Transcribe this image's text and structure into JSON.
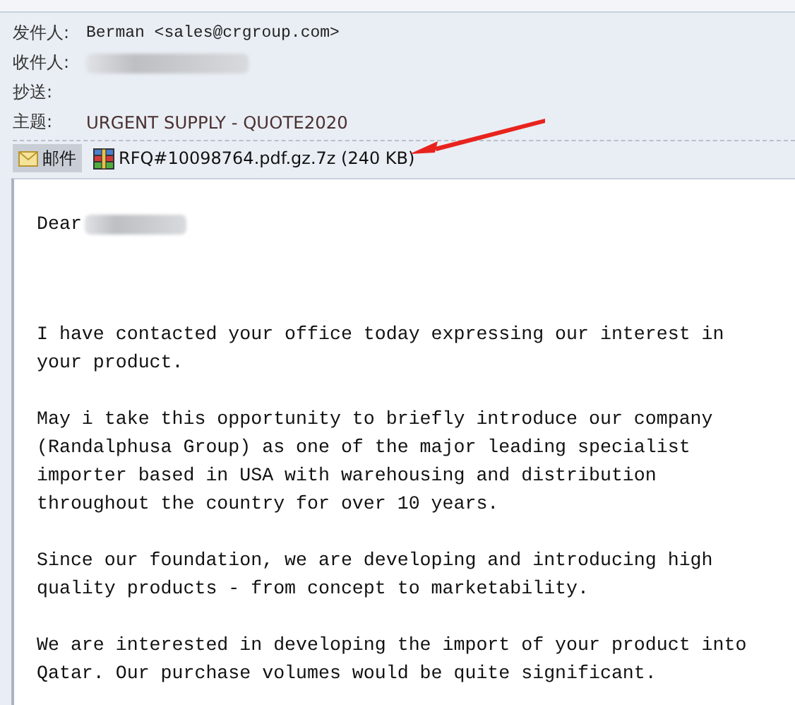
{
  "header": [
    {
      "label": "发件人:",
      "value": "Berman <sales@crgroup.com>"
    },
    {
      "label": "收件人:",
      "redacted": true
    },
    {
      "label": "抄送:"
    },
    {
      "label": "主题:",
      "value": "URGENT SUPPLY - QUOTE2020",
      "kind": "subject"
    }
  ],
  "attachments": [
    {
      "kind": "message",
      "label": "邮件",
      "selected": true
    },
    {
      "kind": "archive",
      "label": "RFQ#10098764.pdf.gz.7z (240 KB)",
      "selected": false
    }
  ],
  "body": {
    "greeting": "Dear",
    "greeting_redacted": true,
    "paragraphs": [
      [
        "I have contacted your office today expressing our interest in",
        "your product."
      ],
      [
        "May i take this opportunity to briefly introduce our company",
        "(Randalphusa Group) as one of the major leading specialist",
        "importer based in USA with warehousing and distribution",
        "throughout the country for over 10 years."
      ],
      [
        "Since our foundation, we are developing and introducing high",
        "quality products - from concept to marketability."
      ],
      [
        "We are interested in developing the import of your product into",
        "Qatar. Our purchase volumes would be quite significant."
      ]
    ]
  }
}
